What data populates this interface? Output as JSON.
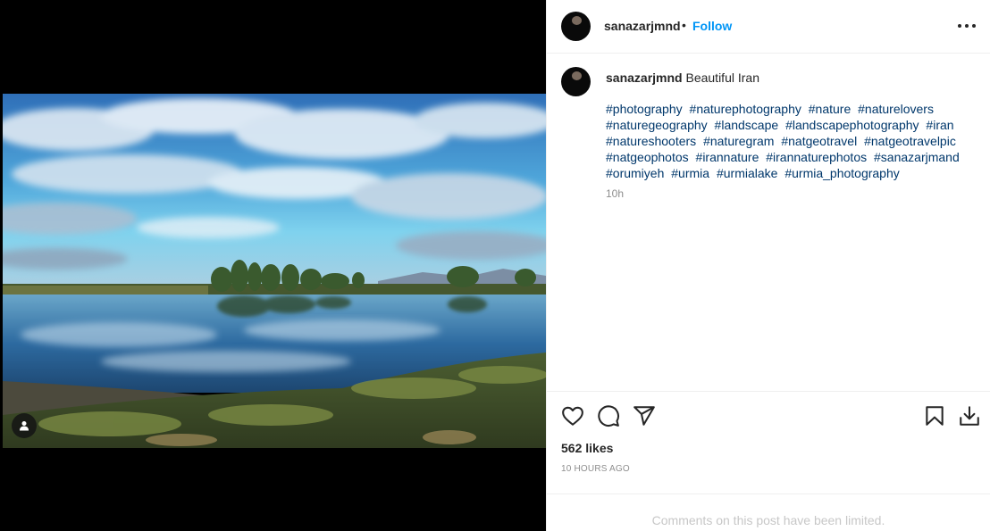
{
  "post": {
    "username": "sanazarjmnd",
    "separator": "•",
    "follow_label": "Follow",
    "more_icon": "more-options-icon",
    "caption_text": "Beautiful Iran",
    "hashtags": [
      "#photography",
      "#naturephotography",
      "#nature",
      "#naturelovers",
      "#naturegeography",
      "#landscape",
      "#landscapephotography",
      "#iran",
      "#natureshooters",
      "#naturegram",
      "#natgeotravel",
      "#natgeotravelpic",
      "#natgeophotos",
      "#irannature",
      "#irannaturephotos",
      "#sanazarjmand",
      "#orumiyeh",
      "#urmia",
      "#urmialake",
      "#urmia_photography"
    ],
    "caption_time": "10h",
    "likes": "562 likes",
    "posted_ago": "10 HOURS AGO",
    "comments_limited": "Comments on this post have been limited."
  },
  "colors": {
    "accent": "#0095f6",
    "hashtag": "#00376b",
    "muted": "#8e8e8e"
  },
  "icons": [
    "heart-icon",
    "comment-icon",
    "share-icon",
    "bookmark-icon",
    "download-icon",
    "user-tag-icon"
  ]
}
